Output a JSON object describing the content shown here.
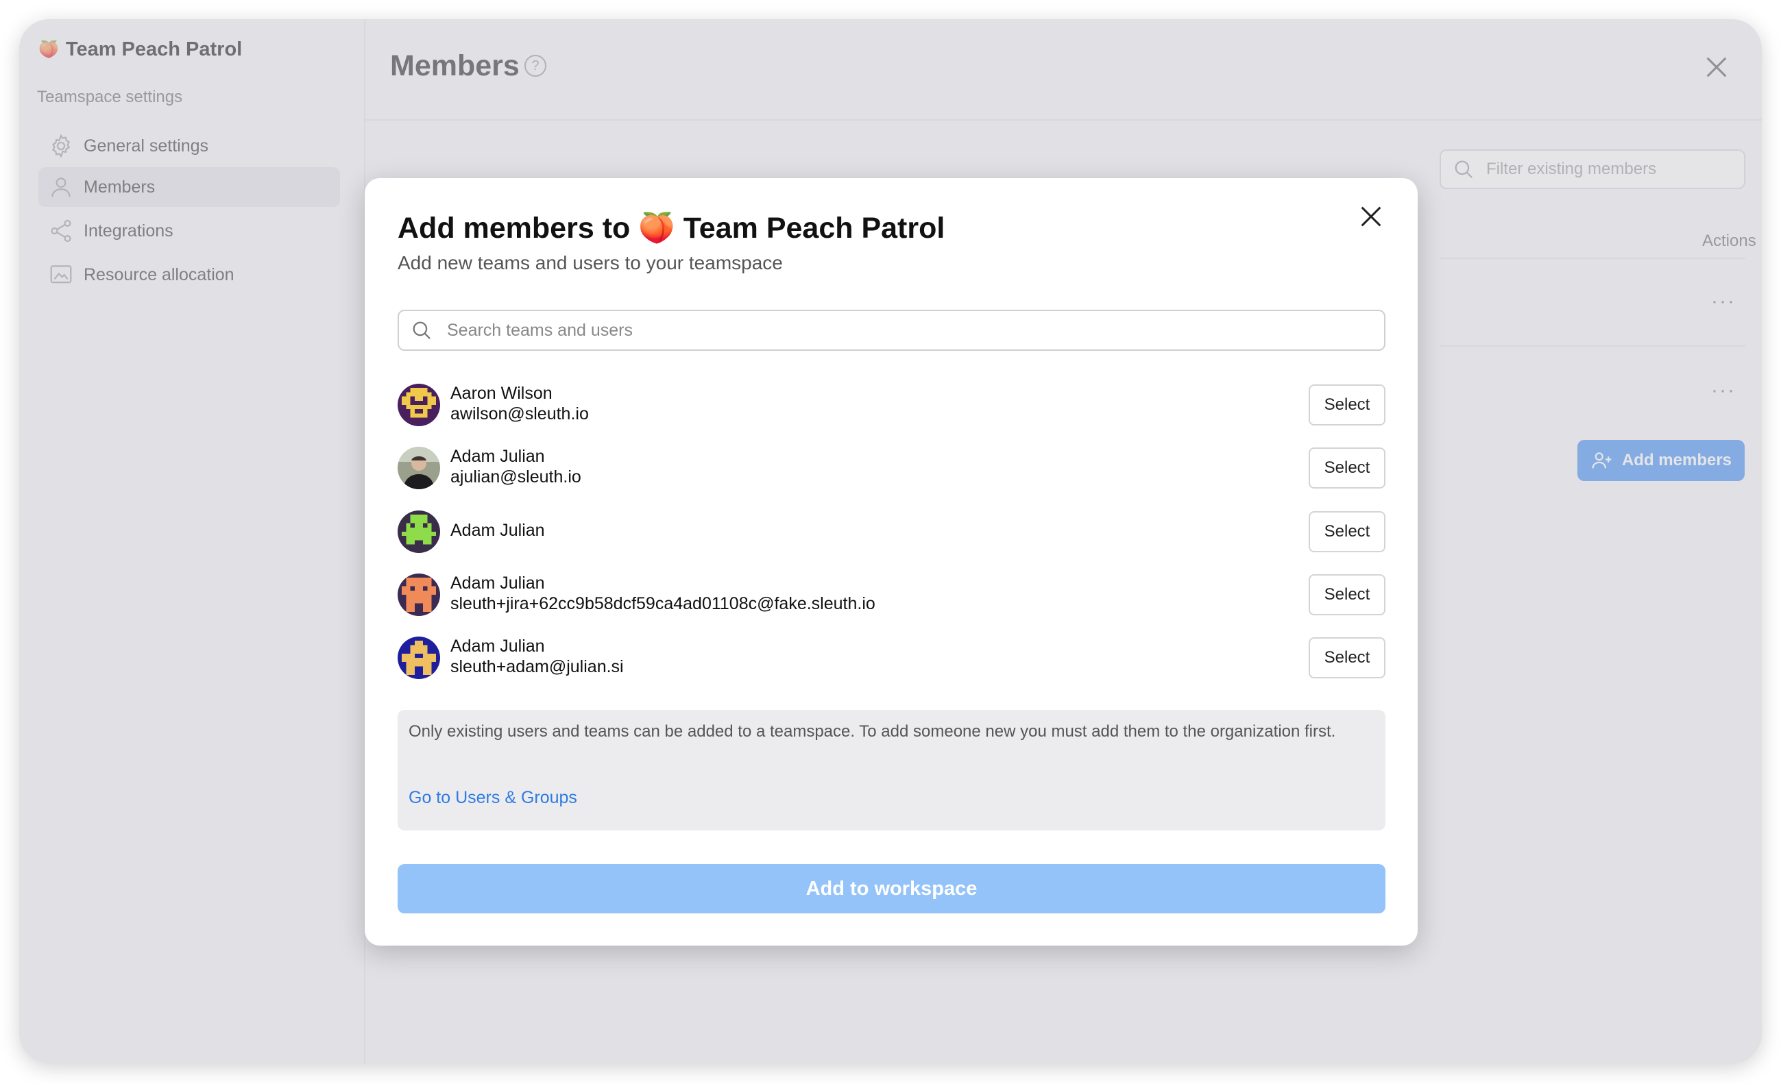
{
  "sidebar": {
    "workspace_icon": "peach-emoji",
    "workspace_name": "Team Peach Patrol",
    "section_title": "Teamspace settings",
    "items": [
      {
        "label": "General settings",
        "icon": "gear-icon"
      },
      {
        "label": "Members",
        "icon": "person-icon",
        "active": true
      },
      {
        "label": "Integrations",
        "icon": "share-nodes-icon"
      },
      {
        "label": "Resource allocation",
        "icon": "chart-image-icon"
      }
    ]
  },
  "main": {
    "title": "Members",
    "help_glyph": "?",
    "filter_placeholder": "Filter existing members",
    "actions_header": "Actions",
    "row_menu_glyph": "···",
    "add_members_label": "Add members"
  },
  "modal": {
    "title_prefix": "Add members to",
    "title_emoji": "🍑",
    "title_team": "Team Peach Patrol",
    "subtitle": "Add new teams and users to your teamspace",
    "search_placeholder": "Search teams and users",
    "users": [
      {
        "name": "Aaron Wilson",
        "email": "awilson@sleuth.io",
        "button": "Select"
      },
      {
        "name": "Adam Julian",
        "email": "ajulian@sleuth.io",
        "button": "Select"
      },
      {
        "name": "Adam Julian",
        "email": "",
        "button": "Select"
      },
      {
        "name": "Adam Julian",
        "email": "sleuth+jira+62cc9b58dcf59ca4ad01108c@fake.sleuth.io",
        "button": "Select"
      },
      {
        "name": "Adam Julian",
        "email": "sleuth+adam@julian.si",
        "button": "Select"
      }
    ],
    "info_text": "Only existing users and teams can be added to a teamspace. To add someone new you must add them to the organization first.",
    "info_link": "Go to Users & Groups",
    "submit_label": "Add to workspace"
  },
  "colors": {
    "accent": "#3d8bf2",
    "submit_disabled": "#93c3f8",
    "link": "#2f7be0"
  }
}
